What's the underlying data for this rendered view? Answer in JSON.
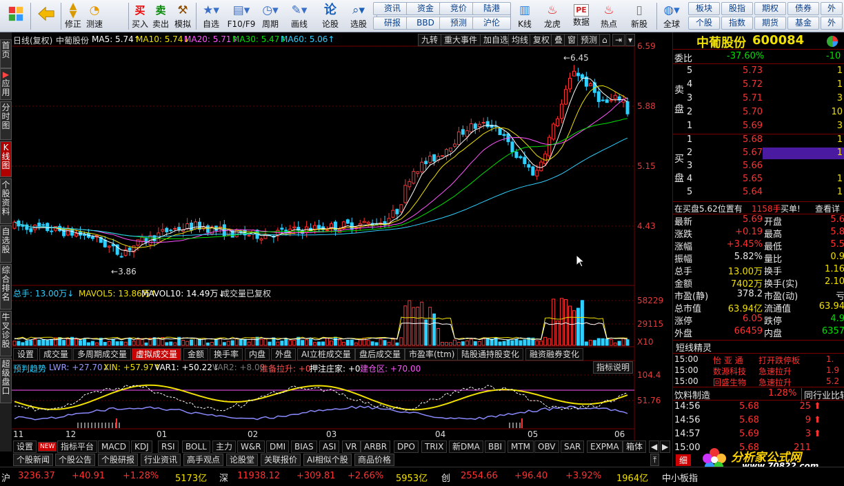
{
  "toolbar": {
    "buttons": [
      {
        "key": "home",
        "label": "",
        "icon": "home-grid-icon"
      },
      {
        "key": "back",
        "label": "",
        "icon": "back-arrow-icon"
      },
      {
        "key": "modify",
        "label": "修正",
        "icon": "up-down-arrows-icon"
      },
      {
        "key": "test",
        "label": "测速",
        "icon": "speed-test-icon"
      },
      {
        "key": "buy",
        "label": "买入",
        "icon": "buy-icon",
        "glyph": "买"
      },
      {
        "key": "sell",
        "label": "卖出",
        "icon": "sell-icon",
        "glyph": "卖"
      },
      {
        "key": "sim",
        "label": "模拟",
        "icon": "hammer-icon"
      },
      {
        "key": "watch",
        "label": "自选",
        "icon": "star-icon"
      },
      {
        "key": "f10",
        "label": "F10/F9",
        "icon": "f10-icon"
      },
      {
        "key": "period",
        "label": "周期",
        "icon": "clock-icon"
      },
      {
        "key": "draw",
        "label": "画线",
        "icon": "pencil-icon"
      },
      {
        "key": "forum",
        "label": "论股",
        "icon": "forum-icon",
        "glyph": "论"
      },
      {
        "key": "pick",
        "label": "选股",
        "icon": "magnifier-chart-icon"
      },
      {
        "key": "kdata",
        "label": "K线",
        "icon": "kline-icon"
      },
      {
        "key": "dragon",
        "label": "龙虎",
        "icon": "dragon-tiger-icon"
      },
      {
        "key": "data",
        "label": "数据",
        "icon": "pe-data-icon"
      },
      {
        "key": "hot",
        "label": "热点",
        "icon": "hot-icon"
      },
      {
        "key": "newipo",
        "label": "新股",
        "icon": "ipo-icon"
      },
      {
        "key": "global",
        "label": "全球",
        "icon": "globe-icon"
      }
    ],
    "quick_row1": [
      "资讯",
      "资金",
      "竞价",
      "陆港"
    ],
    "quick_row2": [
      "研报",
      "BBD",
      "预测",
      "沪伦"
    ],
    "quick_right_row1": [
      "板块",
      "股指",
      "期权",
      "债券",
      "外"
    ],
    "quick_right_row2": [
      "个股",
      "指数",
      "期货",
      "基金",
      "外"
    ]
  },
  "left_tabs": [
    {
      "label": "首页",
      "active": false
    },
    {
      "label": "应用",
      "active": false
    },
    {
      "label": "分时图",
      "active": false
    },
    {
      "label": "K线图",
      "active": true
    },
    {
      "label": "个股资料",
      "active": false
    },
    {
      "label": "自选股",
      "active": false
    },
    {
      "label": "综合排名",
      "active": false
    },
    {
      "label": "牛叉诊股",
      "active": false
    },
    {
      "label": "超级盘口",
      "active": false
    }
  ],
  "chart": {
    "title": "日线(复权)",
    "stock_name": "中葡股份",
    "ma": [
      {
        "label": "MA5: 5.74↑",
        "color": "#ffffff"
      },
      {
        "label": "MA10: 5.74↓",
        "color": "#f0e000"
      },
      {
        "label": "MA20: 5.71↑",
        "color": "#ff55ff"
      },
      {
        "label": "MA30: 5.47↑",
        "color": "#00e000"
      },
      {
        "label": "MA60: 5.06↑",
        "color": "#2fd0ff"
      }
    ],
    "header_buttons": [
      "九转",
      "重大事件",
      "加自选",
      "均线",
      "复权",
      "叠",
      "窗",
      "预测"
    ],
    "price_axis": [
      "6.59",
      "5.88",
      "5.15",
      "4.43"
    ],
    "annotations": {
      "high": "6.45",
      "low": "3.86"
    },
    "volume_header": [
      {
        "label": "总手: 13.00万↓",
        "color": "#2fd0ff"
      },
      {
        "label": "MAVOL5: 13.86万↑",
        "color": "#f0e000"
      },
      {
        "label": "MAVOL10: 14.49万↓",
        "color": "#ffffff"
      },
      {
        "label": "成交量已复权",
        "color": "#dddddd"
      }
    ],
    "volume_axis": [
      "58229",
      "29115",
      "X10"
    ],
    "indicator_tabs": [
      "设置",
      "成交量",
      "多周期成交量",
      "虚拟成交量",
      "金额",
      "换手率",
      "内盘",
      "外盘",
      "AI立桩成交量",
      "盘后成交量",
      "市盈率(ttm)",
      "陆股通持股变化",
      "融资融券变化"
    ],
    "indicator_active": "虚拟成交量",
    "indicator_header": [
      {
        "label": "预判趋势",
        "color": "#2fd0ff"
      },
      {
        "label": "LWR: +27.70↓",
        "color": "#9a9aff"
      },
      {
        "label": "XIN: +57.97↑",
        "color": "#f0e000"
      },
      {
        "label": "VAR1: +50.22↓",
        "color": "#ffffff"
      },
      {
        "label": "VAR2: +8.00",
        "color": "#777777"
      },
      {
        "label": "准备拉升: +0",
        "color": "#ff5050"
      },
      {
        "label": "押注庄家: +0",
        "color": "#ffffff"
      },
      {
        "label": "建仓区: +70.00",
        "color": "#ff55ff"
      }
    ],
    "indicator_help": "指标说明",
    "indicator_axis": [
      "104.4",
      "51.76"
    ],
    "x_axis": [
      "11",
      "12",
      "01",
      "02",
      "03",
      "04",
      "05",
      "06"
    ]
  },
  "bottom_tabs": {
    "row1": [
      "设置",
      "NEW",
      "指标平台",
      "MACD",
      "KDJ",
      "RSI",
      "BOLL",
      "主力",
      "W&R",
      "DMI",
      "BIAS",
      "ASI",
      "VR",
      "ARBR",
      "DPO",
      "TRIX",
      "新DMA",
      "BBI",
      "MTM",
      "OBV",
      "SAR",
      "EXPMA",
      "箱体"
    ],
    "row2": [
      "个股新闻",
      "个股公告",
      "个股研报",
      "行业资讯",
      "高手观点",
      "论股堂",
      "关联报价",
      "AI相似个股",
      "商品价格"
    ]
  },
  "quote": {
    "name": "中葡股份",
    "code": "600084",
    "weibi_label": "委比",
    "weibi": "-37.60%",
    "weicha": "-10",
    "sell_label": "卖盘",
    "buy_label": "买盘",
    "sell": [
      {
        "level": "5",
        "price": "5.73",
        "vol": "1"
      },
      {
        "level": "4",
        "price": "5.72",
        "vol": "1"
      },
      {
        "level": "3",
        "price": "5.71",
        "vol": "3"
      },
      {
        "level": "2",
        "price": "5.70",
        "vol": "10"
      },
      {
        "level": "1",
        "price": "5.69",
        "vol": "3"
      }
    ],
    "buy": [
      {
        "level": "1",
        "price": "5.68",
        "vol": "1"
      },
      {
        "level": "2",
        "price": "5.67",
        "vol": "1"
      },
      {
        "level": "3",
        "price": "5.66",
        "vol": ""
      },
      {
        "level": "4",
        "price": "5.65",
        "vol": "1"
      },
      {
        "level": "5",
        "price": "5.64",
        "vol": "1"
      }
    ],
    "bigorder": {
      "text": "在买盘5.62位置有",
      "qty": "1158手",
      "flag": "买单!",
      "more": "查看详"
    },
    "stats": [
      {
        "l": "最新",
        "v": "5.69",
        "vc": "red",
        "l2": "开盘",
        "v2": "5.6",
        "v2c": "red"
      },
      {
        "l": "涨跌",
        "v": "+0.19",
        "vc": "red",
        "l2": "最高",
        "v2": "5.8",
        "v2c": "red"
      },
      {
        "l": "涨幅",
        "v": "+3.45%",
        "vc": "red",
        "l2": "最低",
        "v2": "5.5",
        "v2c": "red"
      },
      {
        "l": "振幅",
        "v": "5.82%",
        "vc": "wht",
        "l2": "量比",
        "v2": "0.9",
        "v2c": "yel"
      },
      {
        "l": "总手",
        "v": "13.00万",
        "vc": "yel",
        "l2": "换手",
        "v2": "1.16",
        "v2c": "yel"
      },
      {
        "l": "金额",
        "v": "7402万",
        "vc": "yel",
        "l2": "换手(实)",
        "v2": "2.10",
        "v2c": "yel"
      },
      {
        "l": "市盈(静)",
        "v": "378.2",
        "vc": "wht",
        "l2": "市盈(动)",
        "v2": "亏",
        "v2c": "wht"
      },
      {
        "l": "总市值",
        "v": "63.94亿",
        "vc": "yel",
        "l2": "流通值",
        "v2": "63.94",
        "v2c": "yel"
      },
      {
        "l": "涨停",
        "v": "6.05",
        "vc": "red",
        "l2": "跌停",
        "v2": "4.9",
        "v2c": "grn"
      },
      {
        "l": "外盘",
        "v": "66459",
        "vc": "red",
        "l2": "内盘",
        "v2": "6357",
        "v2c": "grn"
      }
    ],
    "sprite_title": "短线精灵",
    "sprites": [
      {
        "t": "15:00",
        "n": "怡 亚 通",
        "e": "打开跌停板",
        "v": "1."
      },
      {
        "t": "15:00",
        "n": "数源科技",
        "e": "急速拉升",
        "v": "1.9"
      },
      {
        "t": "15:00",
        "n": "回盛生物",
        "e": "急速拉升",
        "v": "5.2"
      }
    ],
    "industry": {
      "name": "饮料制造",
      "pct": "1.28%",
      "link": "同行业比较"
    },
    "ticks": [
      {
        "t": "14:56",
        "p": "5.68",
        "v": "25"
      },
      {
        "t": "14:56",
        "p": "5.68",
        "v": "9"
      },
      {
        "t": "14:57",
        "p": "5.69",
        "v": "3"
      },
      {
        "t": "15:00",
        "p": "5.68",
        "v": "211"
      }
    ],
    "detail_tab": "细"
  },
  "status": {
    "sh_label": "沪",
    "sh_index": "3236.37",
    "sh_chg": "+40.91",
    "sh_pct": "+1.28%",
    "sh_amt": "5173亿",
    "sz_label": "深",
    "sz_index": "11938.12",
    "sz_chg": "+309.81",
    "sz_pct": "+2.66%",
    "sz_amt": "5953亿",
    "cy_label": "创",
    "cy_index": "2554.66",
    "cy_chg": "+96.40",
    "cy_pct": "+3.92%",
    "cy_amt": "1964亿",
    "smb_label": "中小板指"
  },
  "watermark": {
    "text": "分析家公式网",
    "url": "www.70822.com"
  }
}
